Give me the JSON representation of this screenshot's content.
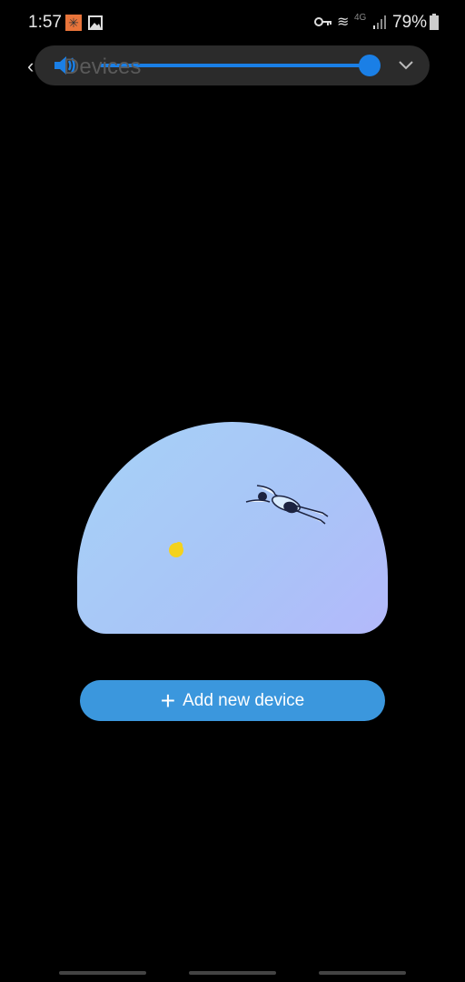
{
  "status_bar": {
    "time": "1:57",
    "battery": "79%",
    "network": "4G"
  },
  "header": {
    "title": "Devices"
  },
  "volume_panel": {
    "level_percent": 100,
    "accent": "#1a7fe6"
  },
  "main": {
    "add_button_label": "Add new device"
  },
  "colors": {
    "button": "#3b97dd",
    "background": "#000000"
  }
}
